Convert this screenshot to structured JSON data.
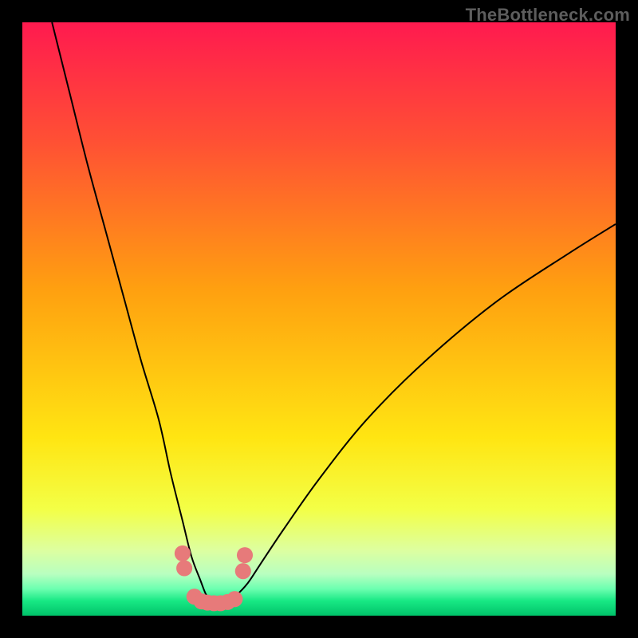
{
  "watermark": "TheBottleneck.com",
  "chart_data": {
    "type": "line",
    "title": "",
    "xlabel": "",
    "ylabel": "",
    "xlim": [
      0,
      100
    ],
    "ylim": [
      0,
      100
    ],
    "grid": false,
    "legend": false,
    "gradient_stops": [
      {
        "offset": 0.0,
        "color": "#ff1a4f"
      },
      {
        "offset": 0.2,
        "color": "#ff5034"
      },
      {
        "offset": 0.45,
        "color": "#ffa010"
      },
      {
        "offset": 0.7,
        "color": "#ffe512"
      },
      {
        "offset": 0.82,
        "color": "#f3ff46"
      },
      {
        "offset": 0.89,
        "color": "#ddffa0"
      },
      {
        "offset": 0.93,
        "color": "#b8ffc0"
      },
      {
        "offset": 0.955,
        "color": "#6cffb0"
      },
      {
        "offset": 0.975,
        "color": "#18e884"
      },
      {
        "offset": 1.0,
        "color": "#00c36a"
      }
    ],
    "series": [
      {
        "name": "bottleneck-curve",
        "stroke": "#000000",
        "stroke_width": 2,
        "x": [
          5,
          8,
          11,
          14,
          17,
          20,
          23,
          25,
          27,
          28.5,
          30,
          31,
          32,
          33,
          34.5,
          36,
          38,
          40,
          44,
          50,
          58,
          68,
          80,
          92,
          100
        ],
        "y": [
          100,
          88,
          76,
          65,
          54,
          43,
          33,
          24,
          16,
          10,
          6,
          3.5,
          2.5,
          2.3,
          2.5,
          3.4,
          5.5,
          8.5,
          14.5,
          23,
          33,
          43,
          53,
          61,
          66
        ]
      },
      {
        "name": "marker-cluster",
        "type": "scatter",
        "marker_color": "#e77a7a",
        "marker_radius_pct": 1.35,
        "x": [
          27.0,
          27.3,
          29.0,
          30.2,
          31.2,
          32.3,
          33.4,
          34.6,
          35.8,
          37.2,
          37.5
        ],
        "y": [
          10.5,
          8.0,
          3.2,
          2.4,
          2.2,
          2.1,
          2.1,
          2.3,
          2.8,
          7.5,
          10.2
        ]
      }
    ]
  }
}
